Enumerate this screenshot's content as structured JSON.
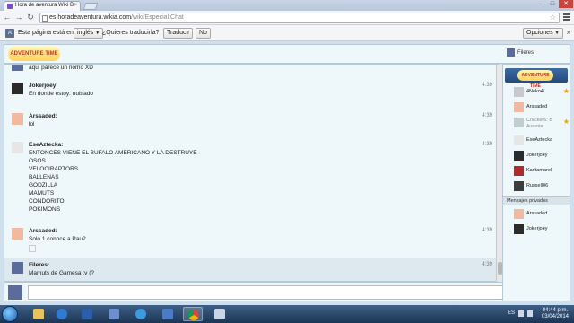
{
  "browser": {
    "tab_title": "Hora de aventura Wiki Bl",
    "tab_close": "×",
    "url_host": "es.horadeaventura.wikia.com",
    "url_path": "/wiki/Especial:Chat",
    "star": "☆",
    "window_buttons": [
      "–",
      "□",
      "✕"
    ]
  },
  "translate_bar": {
    "prefix": "Esta página está en",
    "language": "inglés",
    "question": "¿Quieres traducirla?",
    "translate_button": "Traducir",
    "no_button": "No",
    "options_button": "Opciones",
    "close": "×"
  },
  "chat": {
    "logo_text": "ADVENTURE TIME",
    "header_user": "Fileres",
    "partial_line": "aqui parece un nomo XD",
    "messages": [
      {
        "user": "Jokerjoey:",
        "time": "4:39",
        "lines": [
          "En donde estoy: nublado"
        ],
        "avatar_color": "#2b2b2b"
      },
      {
        "user": "Arssaded:",
        "time": "4:39",
        "lines": [
          "lol"
        ],
        "avatar_color": "#f3b9a0"
      },
      {
        "user": "EseAztecka:",
        "time": "4:39",
        "lines": [
          "ENTONCES VIENE EL BUFALO AMERICANO Y LA DESTRUYE",
          "OSOS",
          "VELOCIRAPTORS",
          "BALLENAS",
          "GODZILLA",
          "MAMUTS",
          "CONDORITO",
          "POKIMONS"
        ],
        "avatar_color": "#e6e6e6"
      },
      {
        "user": "Arssaded:",
        "time": "4:39",
        "lines": [
          "Solo 1 conoce a Pau?"
        ],
        "avatar_color": "#f3b9a0"
      },
      {
        "user": "Fileres:",
        "time": "4:39",
        "lines": [
          "Mamuts de Gamesa :v (?"
        ],
        "avatar_color": "#5c6c9a"
      }
    ]
  },
  "sidebar": {
    "logo_text": "ADVENTURE TIME",
    "users": [
      {
        "name": "4Neko4",
        "starred": true,
        "avatar_color": "#c9c9c9"
      },
      {
        "name": "Arssaded",
        "starred": false,
        "avatar_color": "#f3b9a0"
      },
      {
        "name": "Cracker6: B",
        "sub": "Ausente",
        "starred": true,
        "avatar_color": "#9fb5a9"
      },
      {
        "name": "EseAztecka",
        "starred": false,
        "avatar_color": "#e6e6e6"
      },
      {
        "name": "Jokerjoey",
        "starred": false,
        "avatar_color": "#2b2b2b"
      },
      {
        "name": "Karltamarel",
        "starred": false,
        "avatar_color": "#b22b2b"
      },
      {
        "name": "Russell06",
        "starred": false,
        "avatar_color": "#3d3d3d"
      }
    ],
    "private_label": "Mensajes privados",
    "private_users": [
      {
        "name": "Arssaded",
        "avatar_color": "#f3b9a0"
      },
      {
        "name": "Jokerjoey",
        "avatar_color": "#2b2b2b"
      }
    ]
  },
  "taskbar": {
    "lang": "ES",
    "time": "04:44 p.m.",
    "date": "03/04/2014",
    "apps": [
      "windows-explorer",
      "media-player",
      "word",
      "internet-explorer",
      "uninstaller",
      "chrome",
      "paint"
    ]
  }
}
